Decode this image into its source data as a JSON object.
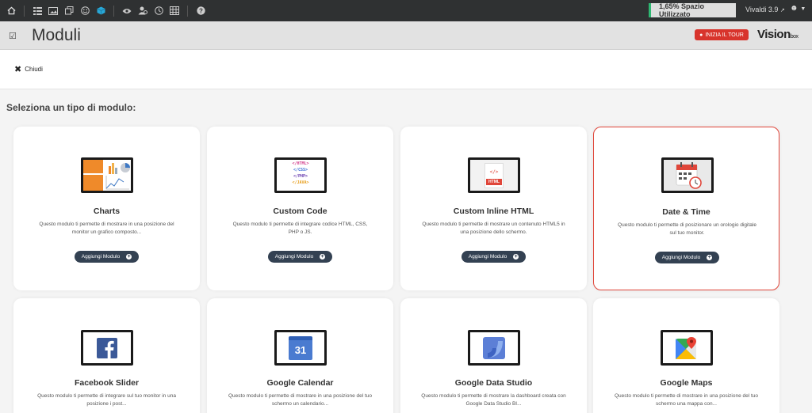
{
  "topbar": {
    "icons": [
      "home-icon",
      "list-icon",
      "image-icon",
      "copy-icon",
      "smile-icon",
      "cube-icon",
      "eye-icon",
      "users-icon",
      "clock-icon",
      "grid-icon",
      "help-icon"
    ],
    "space_label": "1,65% Spazio Utilizzato",
    "version_label": "Vivaldi 3.9",
    "accent": "#2eb872"
  },
  "header": {
    "title": "Moduli",
    "tour_label": "INIZIA IL TOUR",
    "brand_main": "Vision",
    "brand_suffix": "box"
  },
  "close_label": "Chiudi",
  "section_title": "Seleziona un tipo di modulo:",
  "add_label": "Aggiungi Modulo",
  "cards": [
    {
      "title": "Charts",
      "desc": "Questo modulo ti permette di mostrare in una posizione del monitor un grafico composto...",
      "icon": "charts-icon"
    },
    {
      "title": "Custom Code",
      "desc": "Questo modulo ti permette di integrare codice HTML, CSS, PHP o JS.",
      "icon": "code-icon"
    },
    {
      "title": "Custom Inline HTML",
      "desc": "Questo modulo ti permette di mostrare un contenuto HTML5 in una posizione dello schermo.",
      "icon": "html-file-icon"
    },
    {
      "title": "Date & Time",
      "desc": "Questo modulo ti permette di posizionare un orologio digitale sul tuo monitor.",
      "icon": "calendar-clock-icon",
      "selected": true
    },
    {
      "title": "Facebook Slider",
      "desc": "Questo modulo ti permette di integrare sul tuo monitor in una posizione i post...",
      "icon": "facebook-icon"
    },
    {
      "title": "Google Calendar",
      "desc": "Questo modulo ti permette di mostrare in una posizione del tuo schermo un calendario...",
      "icon": "google-calendar-icon",
      "badge": "31"
    },
    {
      "title": "Google Data Studio",
      "desc": "Questo modulo ti permette di mostrare la dashboard creata con Google Data Studio BI...",
      "icon": "data-studio-icon"
    },
    {
      "title": "Google Maps",
      "desc": "Questo modulo ti permette di mostrare in una posizione del tuo schermo una mappa con...",
      "icon": "google-maps-icon"
    }
  ],
  "code_lines": [
    "</HTML>",
    "</CSS>",
    "</PHP>",
    "</JAVA>"
  ],
  "html_label": "HTML",
  "code_glyph": "</>",
  "colors": {
    "button": "#334152",
    "selected_border": "#e0463a",
    "tour": "#d8342c",
    "facebook": "#3b5998",
    "gcal": "#4a7bd0"
  }
}
